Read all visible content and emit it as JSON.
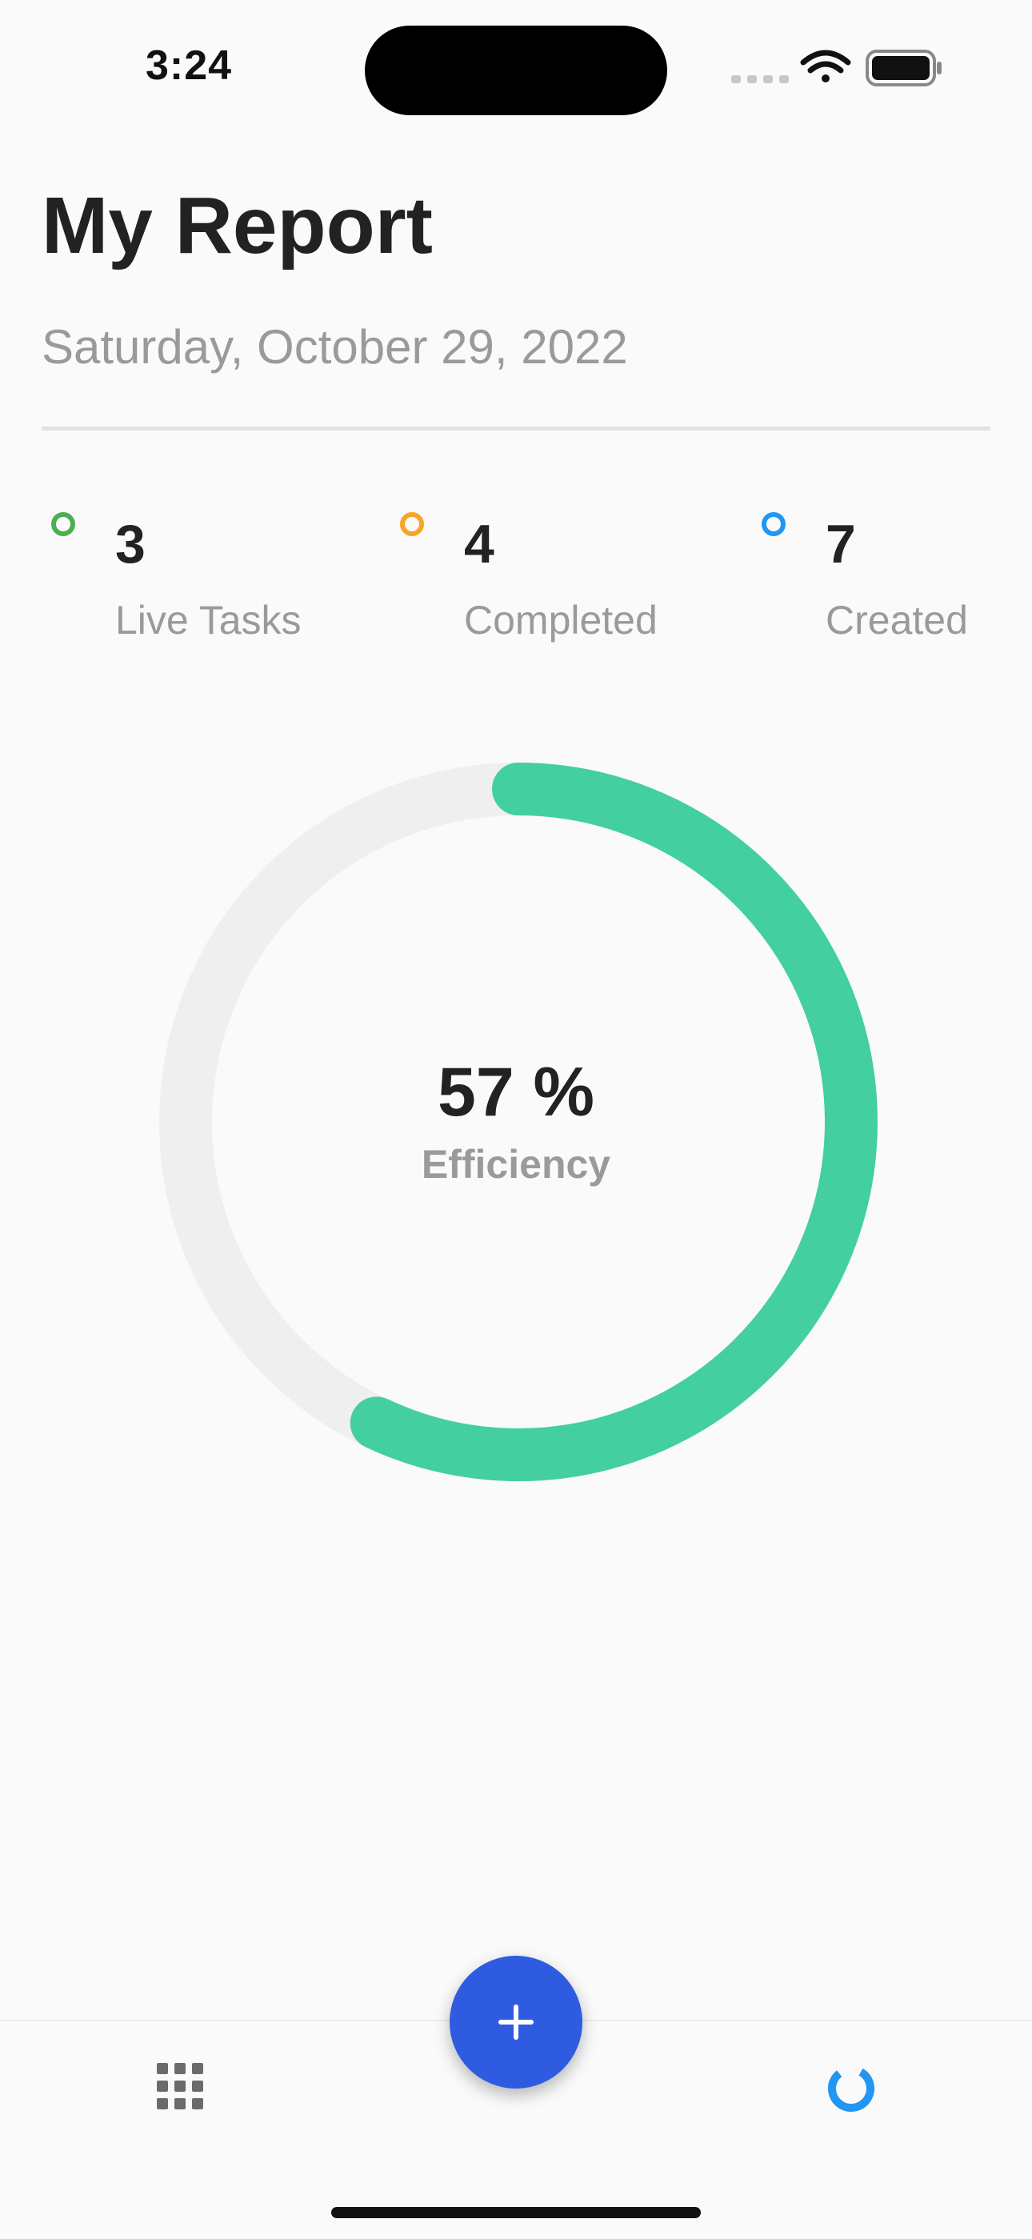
{
  "status_bar": {
    "time": "3:24",
    "icons": [
      "signal-icon",
      "wifi-icon",
      "battery-icon"
    ]
  },
  "header": {
    "title": "My Report",
    "date": "Saturday, October 29, 2022"
  },
  "stats": [
    {
      "value": "3",
      "label": "Live Tasks",
      "color": "#4caf50"
    },
    {
      "value": "4",
      "label": "Completed",
      "color": "#f5a623"
    },
    {
      "value": "7",
      "label": "Created",
      "color": "#2196f3"
    }
  ],
  "efficiency": {
    "value_text": "57 %",
    "fraction": 0.57,
    "caption": "Efficiency",
    "progress_color": "#43cfa0",
    "track_color": "#efefef"
  },
  "bottom_nav": {
    "fab_icon": "plus-icon",
    "items": [
      {
        "icon": "grid-icon",
        "active": false
      },
      {
        "icon": "report-icon",
        "active": true
      }
    ],
    "accent_color": "#2f5be0",
    "active_color": "#2196f3"
  }
}
